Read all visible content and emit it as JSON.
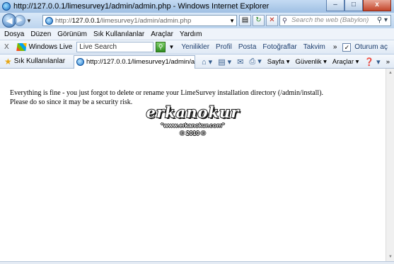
{
  "window": {
    "title": "http://127.0.0.1/limesurvey1/admin/admin.php - Windows Internet Explorer",
    "minimize_label": "–",
    "maximize_label": "□",
    "close_label": "x"
  },
  "address_bar": {
    "url_prefix": "http://",
    "url_host": "127.0.0.1",
    "url_path": "/limesurvey1/admin/admin.php",
    "search_placeholder": "Search the web (Babylon)"
  },
  "menu": {
    "items": [
      "Dosya",
      "Düzen",
      "Görünüm",
      "Sık Kullanılanlar",
      "Araçlar",
      "Yardım"
    ]
  },
  "windows_live_bar": {
    "close_label": "X",
    "brand": "Windows Live",
    "search_placeholder": "Live Search",
    "links": [
      "Yenilikler",
      "Profil",
      "Posta",
      "Fotoğraflar",
      "Takvim"
    ],
    "more": "»",
    "signin": "Oturum aç"
  },
  "favorites_bar": {
    "label": "Sık Kullanılanlar",
    "tab_title": "http://127.0.0.1/limesurvey1/admin/admi..."
  },
  "command_bar": {
    "page": "Sayfa",
    "safety": "Güvenlik",
    "tools": "Araçlar",
    "more": "»"
  },
  "content": {
    "line1": "Everything is fine - you just forgot to delete or rename your LimeSurvey installation directory (/admin/install).",
    "line2": "Please do so since it may be a security risk."
  },
  "watermark": {
    "name": "erkanokur",
    "url": "\"www.erkanokur.com\"",
    "year": "© 2010 ©"
  }
}
